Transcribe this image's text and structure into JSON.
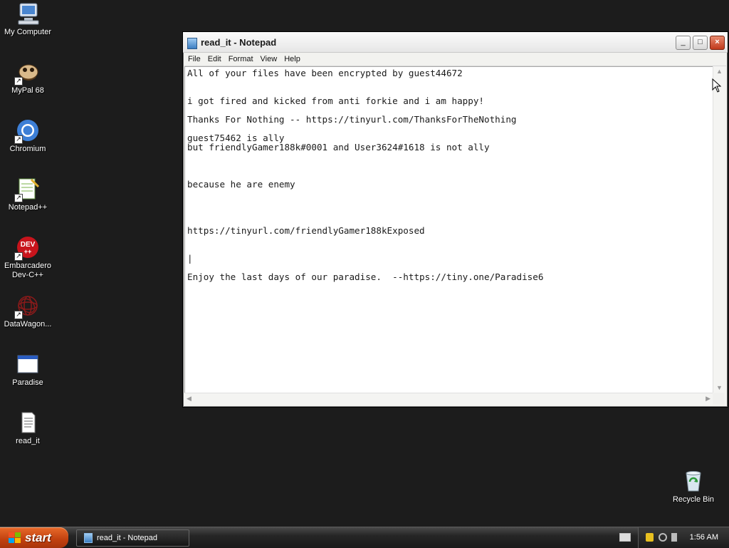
{
  "desktop": {
    "icons": [
      {
        "label": "My Computer",
        "icon": "computer-icon"
      },
      {
        "label": "MyPal 68",
        "icon": "mypal-icon"
      },
      {
        "label": "Chromium",
        "icon": "chromium-icon"
      },
      {
        "label": "Notepad++",
        "icon": "notepadpp-icon"
      },
      {
        "label": "Embarcadero\nDev-C++",
        "icon": "devcpp-icon",
        "badge": "DEV"
      },
      {
        "label": "DataWagon...",
        "icon": "datawagon-icon"
      },
      {
        "label": "Paradise",
        "icon": "program-window-icon"
      },
      {
        "label": "read_it",
        "icon": "text-file-icon"
      },
      {
        "label": "Recycle Bin",
        "icon": "recycle-bin-icon"
      }
    ]
  },
  "window": {
    "title": "read_it - Notepad",
    "buttons": {
      "minimize": "_",
      "maximize": "□",
      "close": "×"
    },
    "menu": [
      "File",
      "Edit",
      "Format",
      "View",
      "Help"
    ],
    "content": "All of your files have been encrypted by guest44672\n\n\ni got fired and kicked from anti forkie and i am happy!\n\nThanks For Nothing -- https://tinyurl.com/ThanksForTheNothing\n\nguest75462 is ally\nbut friendlyGamer188k#0001 and User3624#1618 is not ally\n\n\n\nbecause he are enemy\n\n\n\n\nhttps://tinyurl.com/friendlyGamer188kExposed\n\n\n|\n\nEnjoy the last days of our paradise.  --https://tiny.one/Paradise6"
  },
  "taskbar": {
    "start_label": "start",
    "task_label": "read_it - Notepad",
    "clock": "1:56 AM"
  },
  "colors": {
    "desktop_bg": "#1c1c1c",
    "start_orange": "#c0400f",
    "close_red": "#c13a1c"
  }
}
